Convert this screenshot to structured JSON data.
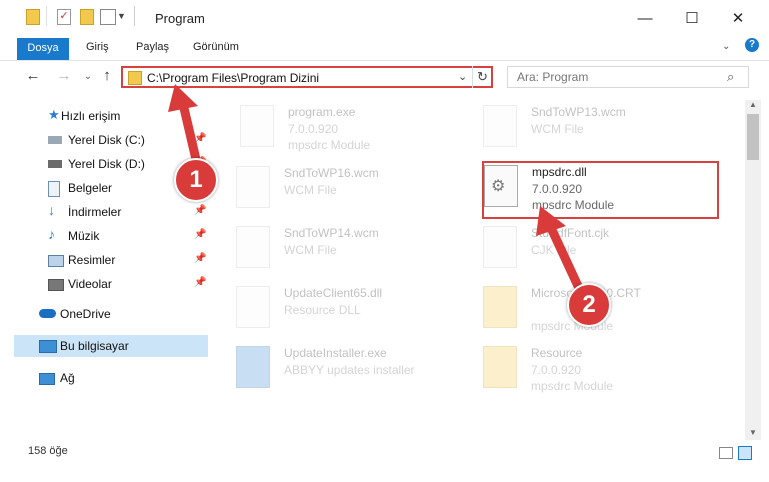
{
  "window": {
    "title": "Program",
    "minimize_glyph": "—",
    "maximize_glyph": "☐",
    "close_glyph": "✕",
    "help_glyph": "?"
  },
  "ribbon": {
    "tabs": [
      "Dosya",
      "Giriş",
      "Paylaş",
      "Görünüm"
    ]
  },
  "address": {
    "path": "C:\\Program Files\\Program Dizini",
    "search_placeholder": "Ara: Program"
  },
  "nav": {
    "items": [
      {
        "label": "Hızlı erişim",
        "icon": "star-icon"
      },
      {
        "label": "Yerel Disk (C:)",
        "icon": "drive-icon"
      },
      {
        "label": "Yerel Disk (D:)",
        "icon": "drive-icon"
      },
      {
        "label": "Belgeler",
        "icon": "documents-icon"
      },
      {
        "label": "İndirmeler",
        "icon": "download-icon"
      },
      {
        "label": "Müzik",
        "icon": "music-icon"
      },
      {
        "label": "Resimler",
        "icon": "pictures-icon"
      },
      {
        "label": "Videolar",
        "icon": "videos-icon"
      },
      {
        "label": "OneDrive",
        "icon": "cloud-icon"
      },
      {
        "label": "Bu bilgisayar",
        "icon": "computer-icon"
      },
      {
        "label": "Ağ",
        "icon": "network-icon"
      }
    ],
    "selected": "Bu bilgisayar"
  },
  "files": [
    {
      "name": "program.exe",
      "line2": "7.0.0.920",
      "line3": "mpsdrc Module"
    },
    {
      "name": "SndToWP13.wcm",
      "line2": "WCM File",
      "line3": ""
    },
    {
      "name": "SndToWP16.wcm",
      "line2": "WCM File",
      "line3": ""
    },
    {
      "name": "mpsdrc.dll",
      "line2": "7.0.0.920",
      "line3": "mpsdrc Module"
    },
    {
      "name": "SndToWP14.wcm",
      "line2": "WCM File",
      "line3": ""
    },
    {
      "name": "StdPdfFont.cjk",
      "line2": "CJK File",
      "line3": ""
    },
    {
      "name": "UpdateClient65.dll",
      "line2": "Resource DLL",
      "line3": ""
    },
    {
      "name": "Microsoft.VC90.CRT",
      "line2": "",
      "line3": "mpsdrc Module"
    },
    {
      "name": "UpdateInstaller.exe",
      "line2": "ABBYY updates installer",
      "line3": ""
    },
    {
      "name": "Resource",
      "line2": "7.0.0.920",
      "line3": "mpsdrc Module"
    }
  ],
  "status": {
    "count": "158 öğe"
  },
  "markers": [
    "1",
    "2"
  ],
  "colors": {
    "accent": "#1979ca",
    "highlight": "#d94040"
  }
}
